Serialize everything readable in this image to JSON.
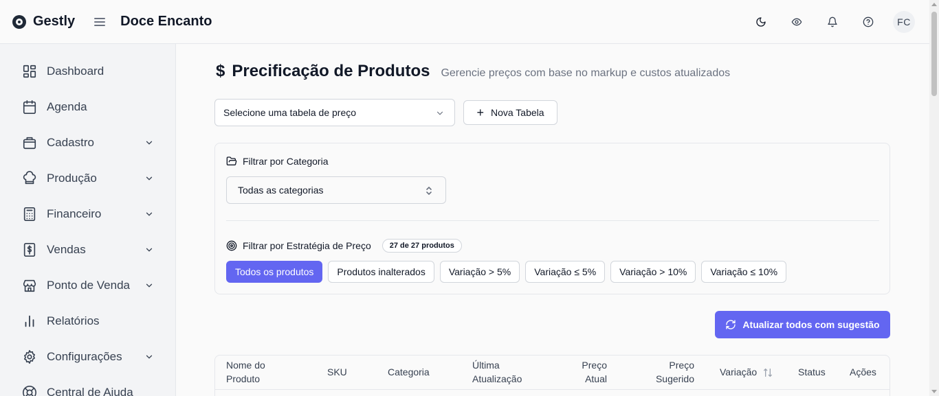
{
  "header": {
    "brand": "Gestly",
    "store": "Doce Encanto",
    "avatar_initials": "FC",
    "icons": [
      "moon-icon",
      "eye-icon",
      "bell-icon",
      "help-icon"
    ]
  },
  "sidebar": {
    "items": [
      {
        "label": "Dashboard",
        "icon": "dashboard-icon",
        "has_children": false
      },
      {
        "label": "Agenda",
        "icon": "calendar-icon",
        "has_children": false
      },
      {
        "label": "Cadastro",
        "icon": "box-icon",
        "has_children": true
      },
      {
        "label": "Produção",
        "icon": "chef-hat-icon",
        "has_children": true
      },
      {
        "label": "Financeiro",
        "icon": "calculator-icon",
        "has_children": true
      },
      {
        "label": "Vendas",
        "icon": "receipt-dollar-icon",
        "has_children": true
      },
      {
        "label": "Ponto de Venda",
        "icon": "store-icon",
        "has_children": true
      },
      {
        "label": "Relatórios",
        "icon": "bar-chart-icon",
        "has_children": false
      },
      {
        "label": "Configurações",
        "icon": "gear-icon",
        "has_children": true
      },
      {
        "label": "Central de Ajuda",
        "icon": "lifebuoy-icon",
        "has_children": false
      }
    ]
  },
  "page": {
    "title_symbol": "$",
    "title": "Precificação de Produtos",
    "subtitle": "Gerencie preços com base no markup e custos atualizados"
  },
  "price_table": {
    "select_label": "Selecione uma tabela de preço",
    "new_button": "Nova Tabela"
  },
  "filters": {
    "category_title": "Filtrar por Categoria",
    "category_value": "Todas as categorias",
    "strategy_title": "Filtrar por Estratégia de Preço",
    "count_badge": "27 de 27 produtos",
    "chips": [
      {
        "label": "Todos os produtos",
        "active": true
      },
      {
        "label": "Produtos inalterados",
        "active": false
      },
      {
        "label": "Variação > 5%",
        "active": false
      },
      {
        "label": "Variação ≤ 5%",
        "active": false
      },
      {
        "label": "Variação > 10%",
        "active": false
      },
      {
        "label": "Variação ≤ 10%",
        "active": false
      }
    ]
  },
  "actions": {
    "update_all": "Atualizar todos com sugestão"
  },
  "table": {
    "columns": {
      "name_1": "Nome do",
      "name_2": "Produto",
      "sku": "SKU",
      "category": "Categoria",
      "updated_1": "Última",
      "updated_2": "Atualização",
      "current_1": "Preço",
      "current_2": "Atual",
      "suggested_1": "Preço",
      "suggested_2": "Sugerido",
      "variation": "Variação",
      "status": "Status",
      "actions": "Ações"
    }
  },
  "colors": {
    "accent": "#6366f1",
    "sidebar_bg": "#f3f4f6",
    "page_bg": "#fafafa",
    "border": "#e5e7eb"
  }
}
